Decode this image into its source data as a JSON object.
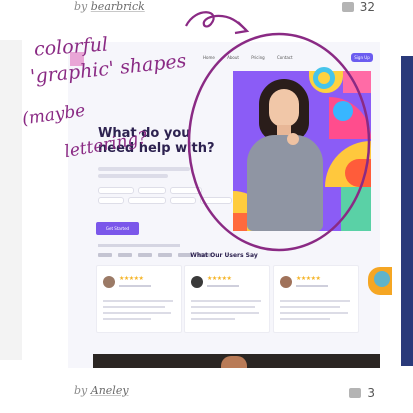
{
  "feed": {
    "top_item": {
      "credit_prefix": "by",
      "author": "bearbrick",
      "likes": "32"
    },
    "bottom_item": {
      "credit_prefix": "by",
      "author": "Aneley",
      "likes": "3"
    }
  },
  "shot": {
    "nav": {
      "links": [
        "Home",
        "About",
        "Pricing",
        "Contact"
      ],
      "cta_label": "Sign Up"
    },
    "hero": {
      "title_line1": "What do you",
      "title_line2": "need help with?",
      "button_label": "Get Started"
    },
    "testimonials": {
      "title": "What Our Users Say",
      "cards": 3,
      "stars": "★★★★★"
    }
  },
  "annotation": {
    "lines": [
      "colorful",
      "'graphic' shapes",
      "(maybe",
      "lettering?"
    ],
    "color": "#8a2a84"
  },
  "colors": {
    "accent": "#7b57ea",
    "ink": "#2d2250",
    "star": "#f5b52a"
  }
}
